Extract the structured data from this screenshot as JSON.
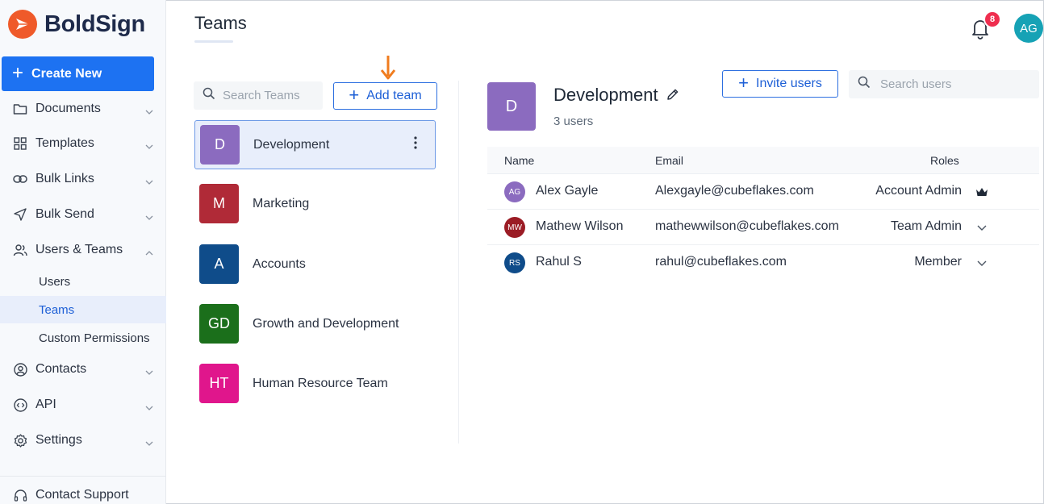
{
  "brand": {
    "name": "BoldSign",
    "accent": "#ef5a2a",
    "primary": "#1d72f2"
  },
  "sidebar": {
    "create_label": "Create New",
    "items": [
      {
        "label": "Documents",
        "icon": "folder-icon"
      },
      {
        "label": "Templates",
        "icon": "grid-icon"
      },
      {
        "label": "Bulk Links",
        "icon": "link-icon"
      },
      {
        "label": "Bulk Send",
        "icon": "send-icon"
      },
      {
        "label": "Users & Teams",
        "icon": "users-icon"
      },
      {
        "label": "Contacts",
        "icon": "contact-icon"
      },
      {
        "label": "API",
        "icon": "api-icon"
      },
      {
        "label": "Settings",
        "icon": "gear-icon"
      }
    ],
    "sub_items": [
      {
        "label": "Users"
      },
      {
        "label": "Teams"
      },
      {
        "label": "Custom Permissions"
      }
    ],
    "support_label": "Contact Support"
  },
  "header": {
    "title": "Teams",
    "notification_count": "8",
    "user_initials": "AG"
  },
  "teams_panel": {
    "search_placeholder": "Search Teams",
    "add_label": "Add team",
    "teams": [
      {
        "initials": "D",
        "name": "Development",
        "color": "#8b6bbf"
      },
      {
        "initials": "M",
        "name": "Marketing",
        "color": "#b02a37"
      },
      {
        "initials": "A",
        "name": "Accounts",
        "color": "#0f4c8a"
      },
      {
        "initials": "GD",
        "name": "Growth and Development",
        "color": "#1b6f1b"
      },
      {
        "initials": "HT",
        "name": "Human Resource Team",
        "color": "#e0168c"
      }
    ]
  },
  "detail": {
    "initials": "D",
    "name": "Development",
    "user_count": "3 users",
    "invite_label": "Invite users",
    "search_placeholder": "Search users",
    "columns": {
      "name": "Name",
      "email": "Email",
      "roles": "Roles"
    },
    "users": [
      {
        "initials": "AG",
        "name": "Alex Gayle",
        "email": "Alexgayle@cubeflakes.com",
        "role": "Account Admin",
        "role_icon": "crown-icon",
        "color": "#8b6bbf"
      },
      {
        "initials": "MW",
        "name": "Mathew Wilson",
        "email": "mathewwilson@cubeflakes.com",
        "role": "Team Admin",
        "role_icon": "chevron-down-icon",
        "color": "#9b1c25"
      },
      {
        "initials": "RS",
        "name": "Rahul S",
        "email": "rahul@cubeflakes.com",
        "role": "Member",
        "role_icon": "chevron-down-icon",
        "color": "#0f4c8a"
      }
    ]
  }
}
